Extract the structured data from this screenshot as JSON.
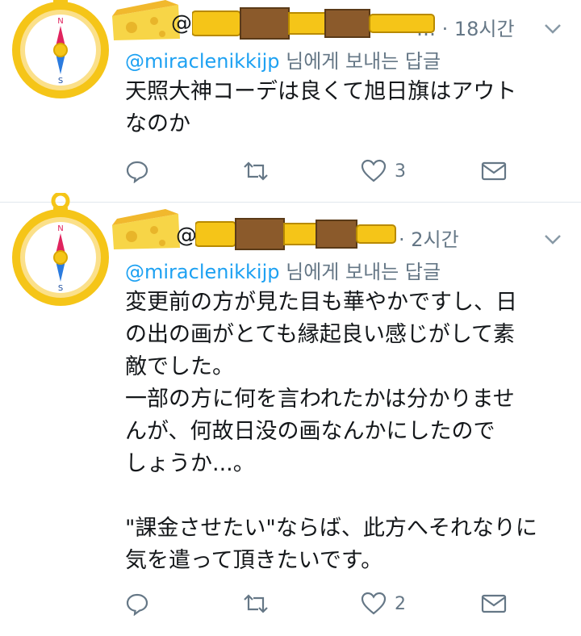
{
  "tweets": [
    {
      "handle_prefix": "@",
      "time": "… · 18시간",
      "reply_label_mention": "@miraclenikkijp",
      "reply_label_suffix": " 님에게 보내는 답글",
      "body": "天照大神コーデは良くて旭日旗はアウト\nなのか",
      "actions": {
        "reply": "",
        "retweet": "",
        "like_count": "3",
        "dm": ""
      }
    },
    {
      "handle_prefix": "@",
      "time": "· 2시간",
      "reply_label_mention": "@miraclenikkijp",
      "reply_label_suffix": " 님에게 보내는 답글",
      "body": "変更前の方が見た目も華やかですし、日\nの出の画がとても縁起良い感じがして素\n敵でした。\n一部の方に何を言われたかは分かりませ\nんが、何故日没の画なんかにしたので\nしょうか...。\n\n\"課金させたい\"ならば、此方へそれなりに\n気を遣って頂きたいです。",
      "actions": {
        "reply": "",
        "retweet": "",
        "like_count": "2",
        "dm": ""
      }
    }
  ],
  "colors": {
    "text": "#14171a",
    "secondary": "#657786",
    "link": "#1da1f2",
    "divider": "#e1e8ed",
    "gold": "#f5c518",
    "cheese": "#f7d547"
  },
  "icons": [
    "compass-avatar-icon",
    "cheese-icon",
    "spyglass-icon",
    "chevron-down-icon",
    "reply-icon",
    "retweet-icon",
    "heart-icon",
    "mail-icon"
  ]
}
